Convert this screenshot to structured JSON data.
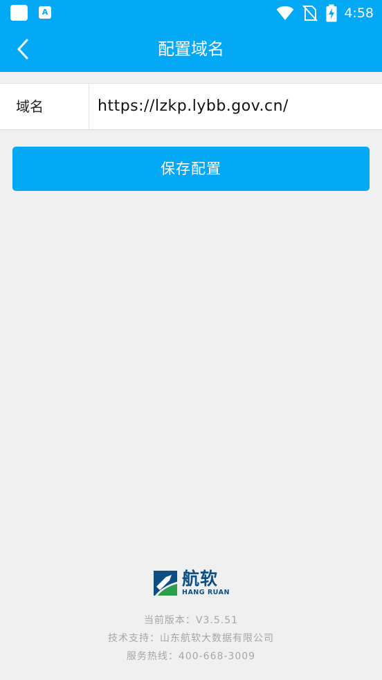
{
  "status_bar": {
    "time": "4:58",
    "icons": [
      "notification-square-icon",
      "app-notification-icon",
      "wifi-icon",
      "no-sim-icon",
      "battery-charging-icon"
    ],
    "app_icon_glyph": "A"
  },
  "header": {
    "title": "配置域名",
    "back_icon": "chevron-left-icon"
  },
  "form": {
    "domain_label": "域名",
    "domain_value": "https://lzkp.lybb.gov.cn/"
  },
  "actions": {
    "save_label": "保存配置"
  },
  "brand": {
    "name_cn": "航软",
    "name_en": "HANG RUAN",
    "color_primary": "#0b4f86",
    "color_secondary": "#2e9e4c"
  },
  "footer": {
    "version": "当前版本：V3.5.51",
    "support": "技术支持：山东航软大数据有限公司",
    "hotline": "服务热线：400-668-3009"
  },
  "colors": {
    "accent": "#03a9f4",
    "background": "#f0f0f0"
  }
}
